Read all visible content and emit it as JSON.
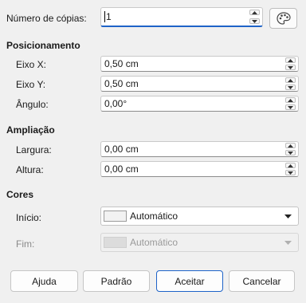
{
  "copies": {
    "label": "Número de cópias:",
    "value": "1"
  },
  "positioning": {
    "title": "Posicionamento",
    "x": {
      "label": "Eixo X:",
      "value": "0,50 cm"
    },
    "y": {
      "label": "Eixo Y:",
      "value": "0,50 cm"
    },
    "angle": {
      "label": "Ângulo:",
      "value": "0,00°"
    }
  },
  "enlargement": {
    "title": "Ampliação",
    "width": {
      "label": "Largura:",
      "value": "0,00 cm"
    },
    "height": {
      "label": "Altura:",
      "value": "0,00 cm"
    }
  },
  "colors": {
    "title": "Cores",
    "start": {
      "label": "Início:",
      "value": "Automático",
      "enabled": true
    },
    "end": {
      "label": "Fim:",
      "value": "Automático",
      "enabled": false
    }
  },
  "buttons": {
    "help": "Ajuda",
    "default": "Padrão",
    "ok": "Aceitar",
    "cancel": "Cancelar"
  }
}
